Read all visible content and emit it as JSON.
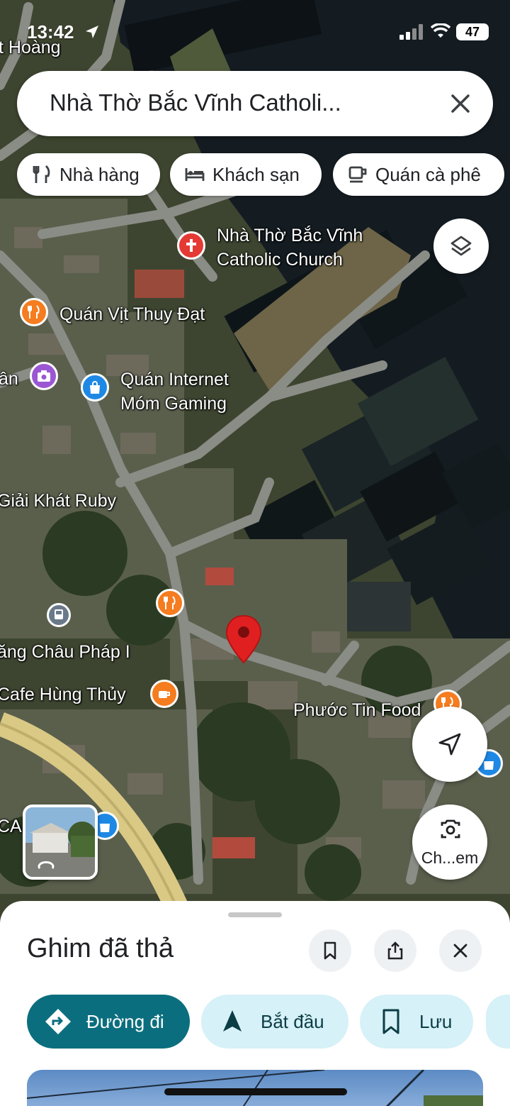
{
  "status_bar": {
    "time": "13:42",
    "battery": "47"
  },
  "search": {
    "query": "Nhà Thờ Bắc Vĩnh Catholi..."
  },
  "chips": [
    {
      "label": "Nhà hàng",
      "icon": "restaurant-icon"
    },
    {
      "label": "Khách sạn",
      "icon": "hotel-icon"
    },
    {
      "label": "Quán cà phê",
      "icon": "cafe-icon"
    }
  ],
  "map": {
    "labels": {
      "top_left": "t Hoàng",
      "church_line1": "Nhà Thờ Bắc Vĩnh",
      "church_line2": "Catholic Church",
      "vit_thuy": "Quán Vịt Thuy Đạt",
      "an": "ân",
      "internet_line1": "Quán Internet",
      "internet_line2": "Móm Gaming",
      "ruby": "Giải Khát Ruby",
      "chau_phap": "ăng Châu Pháp I",
      "hung_thuy": "Cafe Hùng Thủy",
      "phuoc_tin": "Phước Tin Food",
      "can": "CAN"
    },
    "lens_label": "Ch...em"
  },
  "sheet": {
    "title": "Ghim đã thả",
    "actions": [
      {
        "label": "Đường đi",
        "icon": "directions-icon"
      },
      {
        "label": "Bắt đầu",
        "icon": "navigation-icon"
      },
      {
        "label": "Lưu",
        "icon": "bookmark-icon"
      }
    ]
  },
  "colors": {
    "primary_teal": "#0b6e7e",
    "secondary_teal": "#d6f1f7",
    "pin_red": "#e02020",
    "poi_orange": "#f57c1f"
  }
}
